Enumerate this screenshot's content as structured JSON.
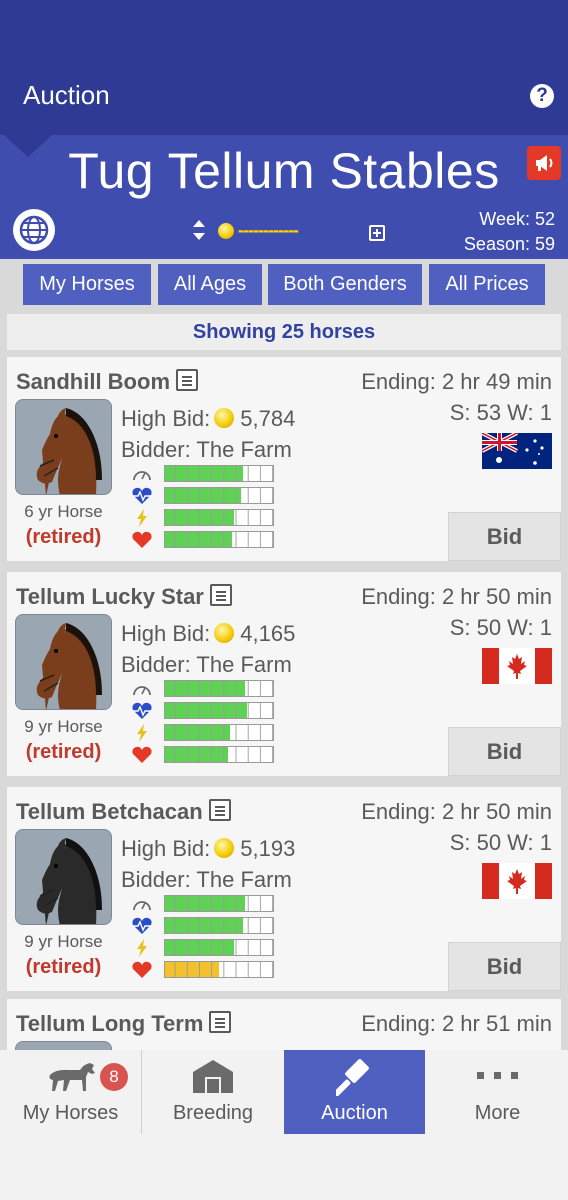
{
  "appbar": {
    "title": "Auction",
    "help_icon": "question-circle-icon"
  },
  "stable": {
    "name": "Tug Tellum Stables",
    "week": "Week: 52",
    "season": "Season: 59",
    "coin_display": "------------",
    "icons": {
      "megaphone": "megaphone-icon",
      "globe": "globe-icon",
      "sort": "sort-updown-icon",
      "coin": "coin-icon",
      "add": "plus-box-icon"
    },
    "colors": {
      "header": "#3f4dae",
      "appbar": "#2e3a93",
      "alert": "#e53927"
    }
  },
  "filters": [
    {
      "label": "My Horses"
    },
    {
      "label": "All Ages"
    },
    {
      "label": "Both Genders"
    },
    {
      "label": "All Prices"
    }
  ],
  "showing": "Showing 25 horses",
  "horses": [
    {
      "name": "Sandhill Boom",
      "ending": "Ending: 2 hr 49 min",
      "sw": "S: 53 W: 1",
      "high_bid_label": "High Bid:",
      "high_bid": "5,784",
      "bidder": "Bidder: The Farm",
      "age": "6 yr Horse",
      "status": "(retired)",
      "flag": "australia",
      "coat": "bay",
      "bid_label": "Bid",
      "stats": [
        {
          "icon": "speed-gauge-icon",
          "fill": 0.72,
          "color": "green"
        },
        {
          "icon": "heartbeat-icon",
          "fill": 0.7,
          "color": "green"
        },
        {
          "icon": "lightning-icon",
          "fill": 0.64,
          "color": "green"
        },
        {
          "icon": "heart-icon",
          "fill": 0.62,
          "color": "green"
        }
      ]
    },
    {
      "name": "Tellum Lucky Star",
      "ending": "Ending: 2 hr 50 min",
      "sw": "S: 50 W: 1",
      "high_bid_label": "High Bid:",
      "high_bid": "4,165",
      "bidder": "Bidder: The Farm",
      "age": "9 yr Horse",
      "status": "(retired)",
      "flag": "canada",
      "coat": "bay",
      "bid_label": "Bid",
      "stats": [
        {
          "icon": "speed-gauge-icon",
          "fill": 0.74,
          "color": "green"
        },
        {
          "icon": "heartbeat-icon",
          "fill": 0.76,
          "color": "green"
        },
        {
          "icon": "lightning-icon",
          "fill": 0.6,
          "color": "green"
        },
        {
          "icon": "heart-icon",
          "fill": 0.58,
          "color": "green"
        }
      ]
    },
    {
      "name": "Tellum Betchacan",
      "ending": "Ending: 2 hr 50 min",
      "sw": "S: 50 W: 1",
      "high_bid_label": "High Bid:",
      "high_bid": "5,193",
      "bidder": "Bidder: The Farm",
      "age": "9 yr Horse",
      "status": "(retired)",
      "flag": "canada",
      "coat": "black",
      "bid_label": "Bid",
      "stats": [
        {
          "icon": "speed-gauge-icon",
          "fill": 0.74,
          "color": "green"
        },
        {
          "icon": "heartbeat-icon",
          "fill": 0.72,
          "color": "green"
        },
        {
          "icon": "lightning-icon",
          "fill": 0.64,
          "color": "green"
        },
        {
          "icon": "heart-icon",
          "fill": 0.5,
          "color": "yellow"
        }
      ]
    },
    {
      "name": "Tellum Long Term",
      "ending": "Ending: 2 hr 51 min"
    }
  ],
  "bottom_nav": [
    {
      "label": "My Horses",
      "icon": "horse-icon",
      "badge": "8"
    },
    {
      "label": "Breeding",
      "icon": "barn-icon"
    },
    {
      "label": "Auction",
      "icon": "gavel-icon",
      "active": true
    },
    {
      "label": "More",
      "icon": "more-dots-icon"
    }
  ]
}
